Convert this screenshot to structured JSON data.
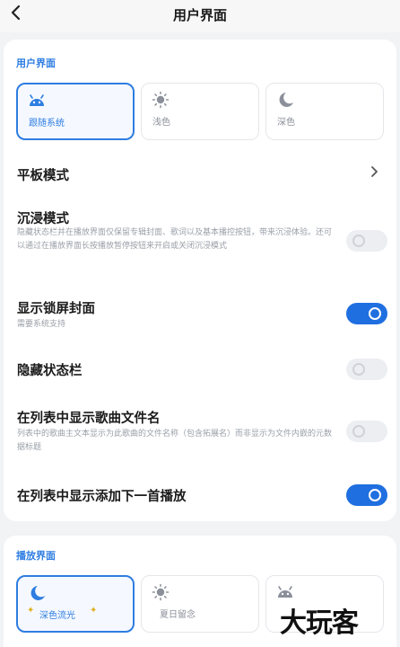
{
  "header": {
    "back_icon": "chevron-left-icon",
    "title": "用户界面"
  },
  "ui_section": {
    "title": "用户界面",
    "modes": [
      {
        "label": "跟随系统",
        "icon": "android-icon",
        "selected": true
      },
      {
        "label": "浅色",
        "icon": "sun-icon",
        "selected": false
      },
      {
        "label": "深色",
        "icon": "moon-icon",
        "selected": false
      }
    ]
  },
  "settings": {
    "tablet_mode": {
      "title": "平板模式"
    },
    "immersive_mode": {
      "title": "沉浸模式",
      "desc": "隐藏状态栏并在播放界面仅保留专辑封面、歌词以及基本播控按钮，带来沉浸体验。还可以通过在播放界面长按播放暂停按钮来开启或关闭沉浸模式",
      "enabled": false
    },
    "lockscreen_cover": {
      "title": "显示锁屏封面",
      "desc": "需要系统支持",
      "enabled": true
    },
    "hide_statusbar": {
      "title": "隐藏状态栏",
      "enabled": false
    },
    "show_filename": {
      "title": "在列表中显示歌曲文件名",
      "desc": "列表中的歌曲主文本显示为此歌曲的文件名称（包含拓展名）而非显示为文件内嵌的元数据标题",
      "enabled": false
    },
    "show_add_next": {
      "title": "在列表中显示添加下一首播放",
      "enabled": true
    }
  },
  "player_section": {
    "title": "播放界面",
    "modes": [
      {
        "label": "深色流光",
        "icon": "moon-icon",
        "selected": true
      },
      {
        "label": "夏日留念",
        "icon": "sun-icon",
        "selected": false
      },
      {
        "label": "",
        "icon": "android-icon",
        "selected": false
      }
    ]
  },
  "watermark": "大玩客",
  "colors": {
    "accent": "#2e7de1",
    "toggle_on": "#1f6fe0",
    "background": "#f2f3f5"
  }
}
